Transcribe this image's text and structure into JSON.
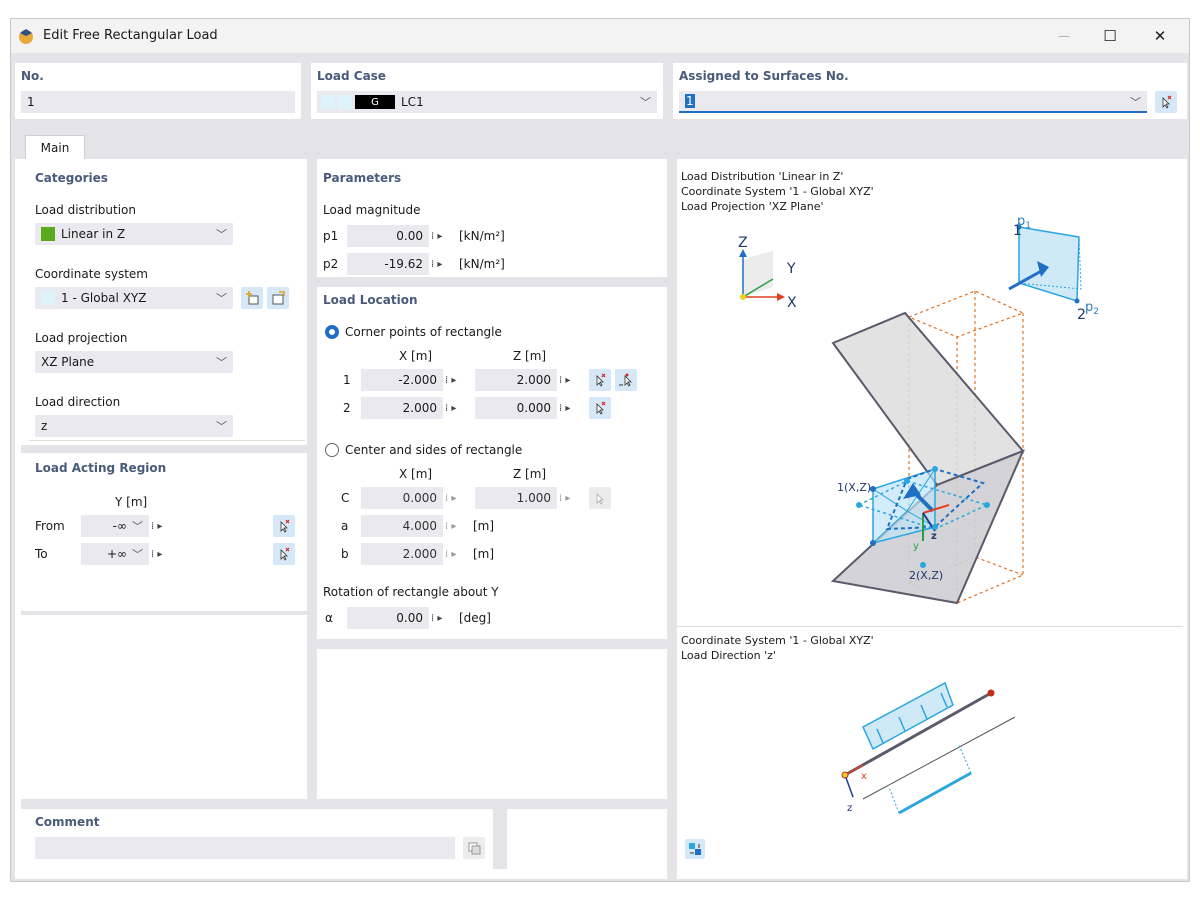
{
  "window": {
    "title": "Edit Free Rectangular Load",
    "minimize": "—",
    "maximize": "☐",
    "close": "✕"
  },
  "top": {
    "no_label": "No.",
    "no_value": "1",
    "loadcase_label": "Load Case",
    "loadcase_badge": "G",
    "loadcase_value": "LC1",
    "surfaces_label": "Assigned to Surfaces No.",
    "surfaces_value": "1"
  },
  "tabs": [
    {
      "label": "Main"
    }
  ],
  "categories": {
    "header": "Categories",
    "load_distribution_label": "Load distribution",
    "load_distribution_value": "Linear in Z",
    "load_distribution_color": "#5aaa1e",
    "coordinate_system_label": "Coordinate system",
    "coordinate_system_value": "1 - Global XYZ",
    "load_projection_label": "Load projection",
    "load_projection_value": "XZ Plane",
    "load_direction_label": "Load direction",
    "load_direction_value": "z"
  },
  "region": {
    "header": "Load Acting Region",
    "col": "Y [m]",
    "from_label": "From",
    "from_value": "-∞",
    "to_label": "To",
    "to_value": "+∞"
  },
  "parameters": {
    "header": "Parameters",
    "magnitude_label": "Load magnitude",
    "p1_label": "p1",
    "p1_value": "0.00",
    "p1_unit": "[kN/m²]",
    "p2_label": "p2",
    "p2_value": "-19.62",
    "p2_unit": "[kN/m²]"
  },
  "location": {
    "header": "Load Location",
    "corner_label": "Corner points of rectangle",
    "xcol": "X [m]",
    "zcol": "Z [m]",
    "rows": [
      {
        "n": "1",
        "x": "-2.000",
        "z": "2.000"
      },
      {
        "n": "2",
        "x": "2.000",
        "z": "0.000"
      }
    ],
    "center_label": "Center and sides of rectangle",
    "c_label": "C",
    "c_x": "0.000",
    "c_z": "1.000",
    "a_label": "a",
    "a_value": "4.000",
    "a_unit": "[m]",
    "b_label": "b",
    "b_value": "2.000",
    "b_unit": "[m]",
    "rotation_label": "Rotation of rectangle about Y",
    "alpha_label": "α",
    "alpha_value": "0.00",
    "alpha_unit": "[deg]"
  },
  "comment": {
    "header": "Comment",
    "value": ""
  },
  "preview": {
    "line1": "Load Distribution 'Linear in Z'",
    "line2": "Coordinate System '1 - Global XYZ'",
    "line3": "Load Projection 'XZ Plane'",
    "axis_z": "Z",
    "axis_y": "Y",
    "axis_x": "X",
    "p1": "p",
    "p1_sub": "1",
    "p2": "p",
    "p2_sub": "2",
    "n1": "1",
    "n2": "2",
    "pt1": "1(X,Z)",
    "pt2": "2(X,Z)",
    "lz": "z",
    "ly": "y",
    "bottom_line1": "Coordinate System '1 - Global XYZ'",
    "bottom_line2": "Load Direction 'z'",
    "bx": "x",
    "bz": "z"
  },
  "colors": {
    "accent": "#1f6fc4",
    "header": "#4a5a7a",
    "field": "#e9e9ef",
    "load": "#2aa6e0"
  }
}
